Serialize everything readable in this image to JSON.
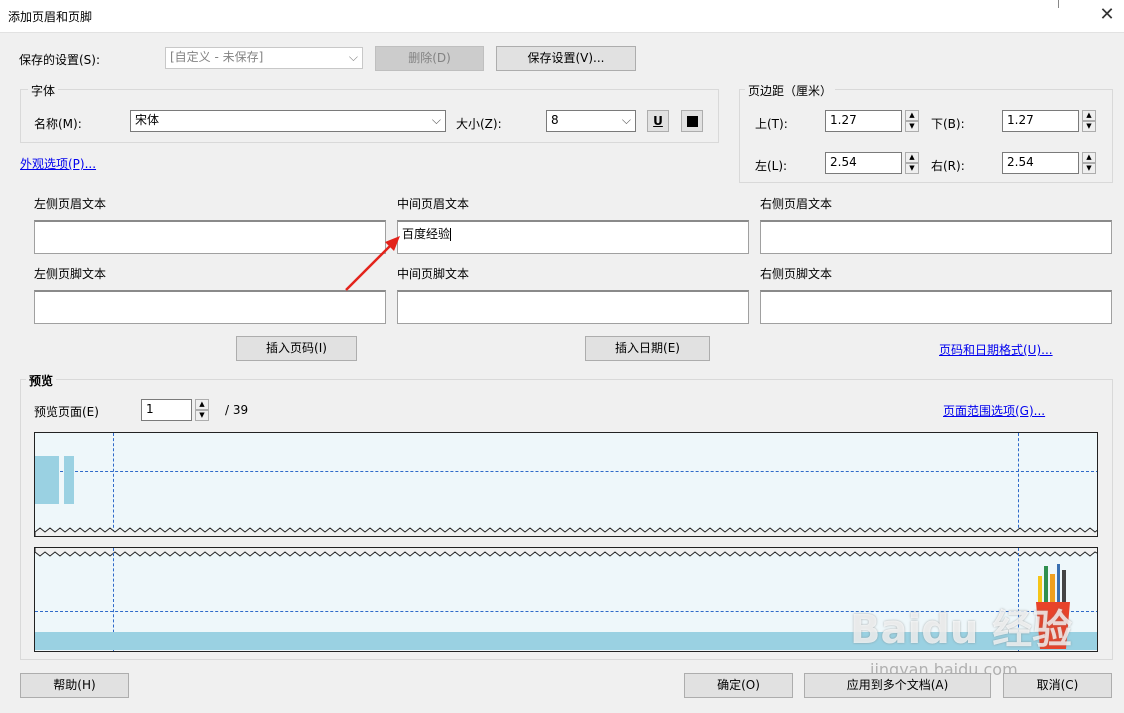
{
  "window": {
    "title": "添加页眉和页脚",
    "close_glyph": "✕"
  },
  "saved": {
    "label": "保存的设置(S):",
    "value": "[自定义 - 未保存]",
    "delete_label": "删除(D)",
    "save_label": "保存设置(V)..."
  },
  "font": {
    "group_label": "字体",
    "name_label": "名称(M):",
    "name_value": "宋体",
    "size_label": "大小(Z):",
    "size_value": "8",
    "underline_glyph": "U"
  },
  "margins": {
    "group_label": "页边距（厘米）",
    "top_label": "上(T):",
    "top_value": "1.27",
    "bottom_label": "下(B):",
    "bottom_value": "1.27",
    "left_label": "左(L):",
    "left_value": "2.54",
    "right_label": "右(R):",
    "right_value": "2.54"
  },
  "appearance_link": "外观选项(P)...",
  "header": {
    "left_label": "左侧页眉文本",
    "center_label": "中间页眉文本",
    "center_value": "百度经验",
    "right_label": "右侧页眉文本"
  },
  "footer": {
    "left_label": "左侧页脚文本",
    "center_label": "中间页脚文本",
    "right_label": "右侧页脚文本"
  },
  "insert": {
    "page_number": "插入页码(I)",
    "date": "插入日期(E)",
    "format_link": "页码和日期格式(U)..."
  },
  "preview": {
    "group_label": "预览",
    "page_label": "预览页面(E)",
    "page_value": "1",
    "page_total": "/ 39",
    "range_link": "页面范围选项(G)..."
  },
  "footer_buttons": {
    "help": "帮助(H)",
    "ok": "确定(O)",
    "apply_multi": "应用到多个文档(A)",
    "cancel": "取消(C)"
  },
  "watermark": "Baidu 经验",
  "watermark_url": "jingyan.baidu.com",
  "colors": {
    "preview_bg": "#eef7fa",
    "preview_bar": "#9ad1e2",
    "arrow": "#e3231b",
    "link": "#0000ee",
    "guide": "#2f6ac9"
  }
}
